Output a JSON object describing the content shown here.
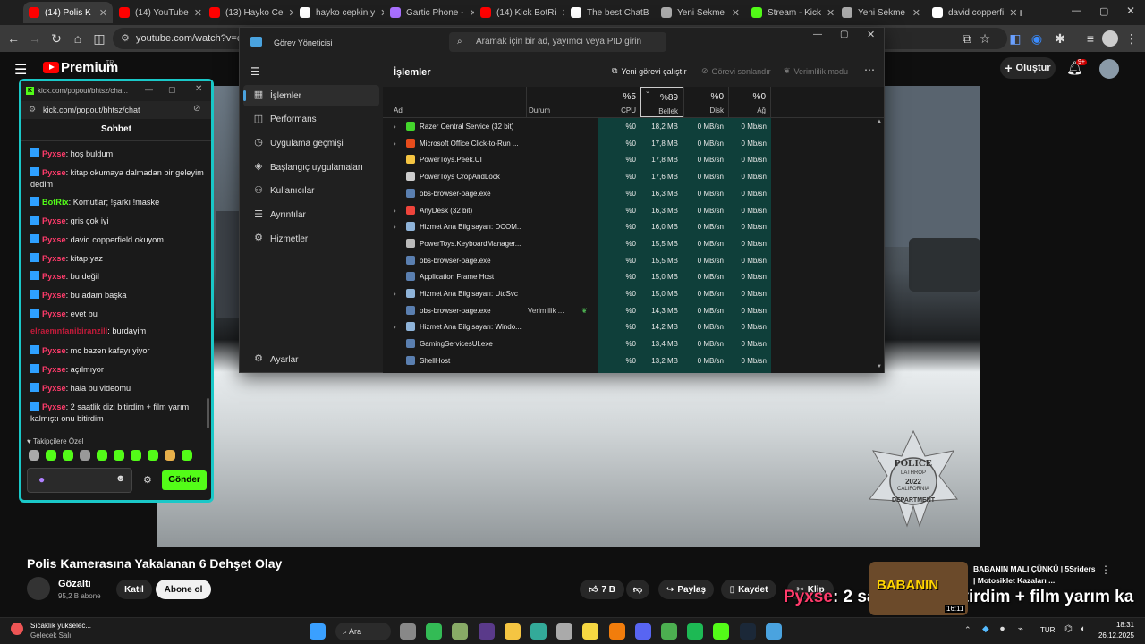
{
  "browser": {
    "tabs": [
      {
        "title": "(14) Polis K",
        "color": "#ff0000"
      },
      {
        "title": "(14) YouTube",
        "color": "#ff0000"
      },
      {
        "title": "(13) Hayko Ce",
        "color": "#ff0000"
      },
      {
        "title": "hayko cepkin y",
        "color": "#ffffff"
      },
      {
        "title": "Gartic Phone -",
        "color": "#a970ff"
      },
      {
        "title": "(14) Kick BotRi",
        "color": "#ff0000"
      },
      {
        "title": "The best ChatB",
        "color": "#ffffff"
      },
      {
        "title": "Yeni Sekme",
        "color": "#aaaaaa"
      },
      {
        "title": "Stream - Kick",
        "color": "#53fc18"
      },
      {
        "title": "Yeni Sekme",
        "color": "#aaaaaa"
      },
      {
        "title": "david copperfi",
        "color": "#ffffff"
      }
    ],
    "new_tab": "+",
    "url": "youtube.com/watch?v=cGM"
  },
  "youtube": {
    "logo": "Premium",
    "logo_sup": "TR",
    "create_label": "Oluştur",
    "notif_count": "9+",
    "video_title": "Polis Kamerasına Yakalanan 6 Dehşet Olay",
    "channel_name": "Gözaltı",
    "subscribers": "95,2 B abone",
    "join_label": "Katıl",
    "subscribe_label": "Abone ol",
    "likes": "7 B",
    "share_label": "Paylaş",
    "save_label": "Kaydet",
    "clip_label": "Klip",
    "overlay_user": "Pyxse",
    "overlay_text": ": 2 saatlik dizi bitirdim + film yarım ka",
    "recommended": {
      "thumb_text": "BABANIN",
      "duration": "16:11",
      "title": "BABANIN MALI ÇÜNKÜ | 5Sriders | Motosiklet Kazaları ..."
    },
    "police_badge": [
      "POLICE",
      "LATHROP",
      "2022",
      "CALIFORNIA",
      "DEPARTMENT"
    ]
  },
  "taskmanager": {
    "title": "Görev Yöneticisi",
    "search_placeholder": "Aramak için bir ad, yayımcı veya PID girin",
    "section_title": "İşlemler",
    "run_task": "Yeni görevi çalıştır",
    "end_task": "Görevi sonlandır",
    "efficiency": "Verimlilik modu",
    "nav": [
      {
        "label": "İşlemler",
        "icon": "▦"
      },
      {
        "label": "Performans",
        "icon": "◫"
      },
      {
        "label": "Uygulama geçmişi",
        "icon": "◷"
      },
      {
        "label": "Başlangıç uygulamaları",
        "icon": "◈"
      },
      {
        "label": "Kullanıcılar",
        "icon": "⚇"
      },
      {
        "label": "Ayrıntılar",
        "icon": "☰"
      },
      {
        "label": "Hizmetler",
        "icon": "⚙"
      }
    ],
    "settings": "Ayarlar",
    "columns": {
      "name": "Ad",
      "status": "Durum",
      "cpu_pct": "%5",
      "cpu": "CPU",
      "mem_pct": "%89",
      "mem": "Bellek",
      "disk_pct": "%0",
      "disk": "Disk",
      "net_pct": "%0",
      "net": "Ağ"
    },
    "processes": [
      {
        "name": "Razer Central Service (32 bit)",
        "status": "",
        "cpu": "%0",
        "mem": "18,2 MB",
        "disk": "0 MB/sn",
        "net": "0 Mb/sn",
        "expand": true,
        "icon": "#44d62c"
      },
      {
        "name": "Microsoft Office Click-to-Run ...",
        "status": "",
        "cpu": "%0",
        "mem": "17,8 MB",
        "disk": "0 MB/sn",
        "net": "0 Mb/sn",
        "expand": true,
        "icon": "#e74c1c"
      },
      {
        "name": "PowerToys.Peek.UI",
        "status": "",
        "cpu": "%0",
        "mem": "17,8 MB",
        "disk": "0 MB/sn",
        "net": "0 Mb/sn",
        "expand": false,
        "icon": "#f5c542"
      },
      {
        "name": "PowerToys CropAndLock",
        "status": "",
        "cpu": "%0",
        "mem": "17,6 MB",
        "disk": "0 MB/sn",
        "net": "0 Mb/sn",
        "expand": false,
        "icon": "#cccccc"
      },
      {
        "name": "obs-browser-page.exe",
        "status": "",
        "cpu": "%0",
        "mem": "16,3 MB",
        "disk": "0 MB/sn",
        "net": "0 Mb/sn",
        "expand": false,
        "icon": "#5a7fb0"
      },
      {
        "name": "AnyDesk (32 bit)",
        "status": "",
        "cpu": "%0",
        "mem": "16,3 MB",
        "disk": "0 MB/sn",
        "net": "0 Mb/sn",
        "expand": true,
        "icon": "#ef443b"
      },
      {
        "name": "Hizmet Ana Bilgisayarı: DCOM...",
        "status": "",
        "cpu": "%0",
        "mem": "16,0 MB",
        "disk": "0 MB/sn",
        "net": "0 Mb/sn",
        "expand": true,
        "icon": "#8fb4d9"
      },
      {
        "name": "PowerToys.KeyboardManager...",
        "status": "",
        "cpu": "%0",
        "mem": "15,5 MB",
        "disk": "0 MB/sn",
        "net": "0 Mb/sn",
        "expand": false,
        "icon": "#bbbbbb"
      },
      {
        "name": "obs-browser-page.exe",
        "status": "",
        "cpu": "%0",
        "mem": "15,5 MB",
        "disk": "0 MB/sn",
        "net": "0 Mb/sn",
        "expand": false,
        "icon": "#5a7fb0"
      },
      {
        "name": "Application Frame Host",
        "status": "",
        "cpu": "%0",
        "mem": "15,0 MB",
        "disk": "0 MB/sn",
        "net": "0 Mb/sn",
        "expand": false,
        "icon": "#5a7fb0"
      },
      {
        "name": "Hizmet Ana Bilgisayarı: UtcSvc",
        "status": "",
        "cpu": "%0",
        "mem": "15,0 MB",
        "disk": "0 MB/sn",
        "net": "0 Mb/sn",
        "expand": true,
        "icon": "#8fb4d9"
      },
      {
        "name": "obs-browser-page.exe",
        "status": "Verimlilik ...",
        "cpu": "%0",
        "mem": "14,3 MB",
        "disk": "0 MB/sn",
        "net": "0 Mb/sn",
        "expand": false,
        "icon": "#5a7fb0"
      },
      {
        "name": "Hizmet Ana Bilgisayarı: Windo...",
        "status": "",
        "cpu": "%0",
        "mem": "14,2 MB",
        "disk": "0 MB/sn",
        "net": "0 Mb/sn",
        "expand": true,
        "icon": "#8fb4d9"
      },
      {
        "name": "GamingServicesUI.exe",
        "status": "",
        "cpu": "%0",
        "mem": "13,4 MB",
        "disk": "0 MB/sn",
        "net": "0 Mb/sn",
        "expand": false,
        "icon": "#5a7fb0"
      },
      {
        "name": "ShellHost",
        "status": "",
        "cpu": "%0",
        "mem": "13,2 MB",
        "disk": "0 MB/sn",
        "net": "0 Mb/sn",
        "expand": false,
        "icon": "#5a7fb0"
      }
    ]
  },
  "kick": {
    "window_url": "kick.com/popout/bhtsz/cha...",
    "address": "kick.com/popout/bhtsz/chat",
    "header": "Sohbet",
    "messages": [
      {
        "user": "Pyxse",
        "text": ": hoş buldum"
      },
      {
        "user": "Pyxse",
        "text": ": kitap okumaya dalmadan bir geleyim dedim"
      },
      {
        "user": "BotRix",
        "text": ": Komutlar; !şarkı !maske"
      },
      {
        "user": "Pyxse",
        "text": ": gris çok iyi"
      },
      {
        "user": "Pyxse",
        "text": ": david copperfield okuyom"
      },
      {
        "user": "Pyxse",
        "text": ": kitap yaz"
      },
      {
        "user": "Pyxse",
        "text": ": bu değil"
      },
      {
        "user": "Pyxse",
        "text": ": bu adam başka"
      },
      {
        "user": "Pyxse",
        "text": ": evet bu"
      },
      {
        "user": "elraemnfanibiranzili",
        "text": ": burdayim"
      },
      {
        "user": "Pyxse",
        "text": ": mc bazen kafayı yiyor"
      },
      {
        "user": "Pyxse",
        "text": ": açılmıyor"
      },
      {
        "user": "Pyxse",
        "text": ": hala bu videomu"
      },
      {
        "user": "Pyxse",
        "text": ": 2 saatlik dizi bitirdim + film yarım kalmıştı onu bitirdim"
      }
    ],
    "followers_label": "Takipçilere Özel",
    "send_label": "Gönder"
  },
  "taskbar": {
    "weather_title": "Sıcaklık yükselec...",
    "weather_sub": "Gelecek Salı",
    "search_label": "Ara",
    "lang": "TUR",
    "time": "18:31",
    "date": "26.12.2025"
  }
}
